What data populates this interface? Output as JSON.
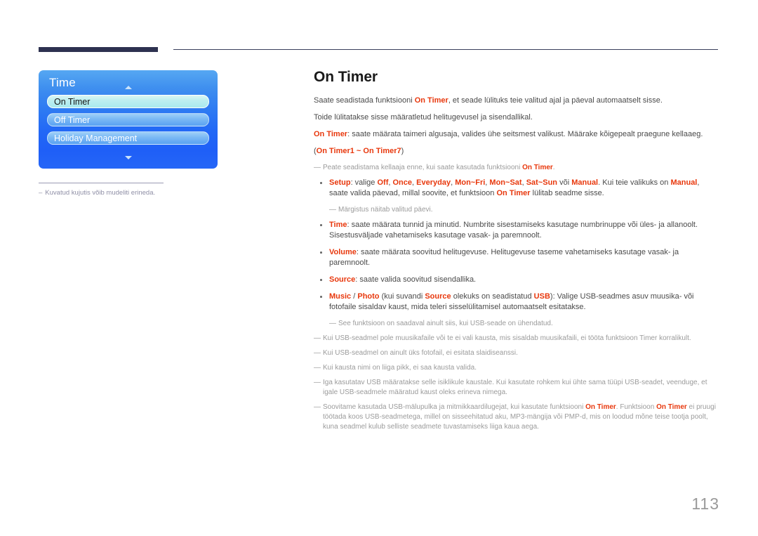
{
  "accent_color": "#e8380d",
  "panel_blue": "#2268f6",
  "rule_color": "#2e3250",
  "header": {
    "rule_block_label": "header-rule-block",
    "rule_line_label": "header-rule-line"
  },
  "osd": {
    "title": "Time",
    "up_arrow": "chevron-up-icon",
    "down_arrow": "chevron-down-icon",
    "items": [
      {
        "label": "On Timer",
        "selected": true
      },
      {
        "label": "Off Timer",
        "selected": false
      },
      {
        "label": "Holiday Management",
        "selected": false
      }
    ],
    "caption_dash": "–",
    "caption": "Kuvatud kujutis võib mudeliti erineda."
  },
  "doc": {
    "title": "On Timer",
    "page_number": "113",
    "paragraphs": [
      {
        "id": "intro1",
        "runs": [
          {
            "t": "Saate seadistada funktsiooni ",
            "hl": false
          },
          {
            "t": "On Timer",
            "hl": true
          },
          {
            "t": ", et seade lülituks teie valitud ajal ja päeval automaatselt sisse.",
            "hl": false
          }
        ]
      },
      {
        "id": "intro2",
        "runs": [
          {
            "t": "Toide lülitatakse sisse määratletud helitugevusel ja sisendallikal.",
            "hl": false
          }
        ]
      },
      {
        "id": "intro3",
        "runs": [
          {
            "t": "On Timer",
            "hl": true
          },
          {
            "t": ": saate määrata taimeri algusaja, valides ühe seitsmest valikust. Määrake kõigepealt praegune kellaaeg.",
            "hl": false
          }
        ]
      },
      {
        "id": "intro4",
        "runs": [
          {
            "t": "(",
            "hl": false
          },
          {
            "t": "On Timer1 ~ On Timer7",
            "hl": true
          },
          {
            "t": ")",
            "hl": false
          }
        ]
      }
    ],
    "note_after_intro": {
      "dash": "—",
      "runs": [
        {
          "t": "Peate seadistama kellaaja enne, kui saate kasutada funktsiooni ",
          "hl": false
        },
        {
          "t": "On Timer",
          "hl": true
        },
        {
          "t": ".",
          "hl": false
        }
      ]
    },
    "bullets": [
      {
        "id": "setup",
        "runs": [
          {
            "t": "Setup",
            "hl": true
          },
          {
            "t": ": valige ",
            "hl": false
          },
          {
            "t": "Off",
            "hl": true
          },
          {
            "t": ", ",
            "hl": false
          },
          {
            "t": "Once",
            "hl": true
          },
          {
            "t": ", ",
            "hl": false
          },
          {
            "t": "Everyday",
            "hl": true
          },
          {
            "t": ", ",
            "hl": false
          },
          {
            "t": "Mon~Fri",
            "hl": true
          },
          {
            "t": ", ",
            "hl": false
          },
          {
            "t": "Mon~Sat",
            "hl": true
          },
          {
            "t": ", ",
            "hl": false
          },
          {
            "t": "Sat~Sun",
            "hl": true
          },
          {
            "t": " või ",
            "hl": false
          },
          {
            "t": "Manual",
            "hl": true
          },
          {
            "t": ". Kui teie valikuks on ",
            "hl": false
          },
          {
            "t": "Manual",
            "hl": true
          },
          {
            "t": ", saate valida päevad, millal soovite, et funktsioon ",
            "hl": false
          },
          {
            "t": "On Timer",
            "hl": true
          },
          {
            "t": " lülitab seadme sisse.",
            "hl": false
          }
        ],
        "note": {
          "dash": "—",
          "runs": [
            {
              "t": "Märgistus näitab valitud päevi.",
              "hl": false
            }
          ]
        }
      },
      {
        "id": "time",
        "runs": [
          {
            "t": "Time",
            "hl": true
          },
          {
            "t": ": saate määrata tunnid ja minutid. Numbrite sisestamiseks kasutage numbrinuppe või üles- ja allanoolt. Sisestusväljade vahetamiseks kasutage vasak- ja paremnoolt.",
            "hl": false
          }
        ]
      },
      {
        "id": "volume",
        "runs": [
          {
            "t": "Volume",
            "hl": true
          },
          {
            "t": ": saate määrata soovitud helitugevuse. Helitugevuse taseme vahetamiseks kasutage vasak- ja paremnoolt.",
            "hl": false
          }
        ]
      },
      {
        "id": "source",
        "runs": [
          {
            "t": "Source",
            "hl": true
          },
          {
            "t": ": saate valida soovitud sisendallika.",
            "hl": false
          }
        ]
      },
      {
        "id": "music-photo",
        "runs": [
          {
            "t": "Music",
            "hl": true
          },
          {
            "t": " / ",
            "hl": false
          },
          {
            "t": "Photo",
            "hl": true
          },
          {
            "t": " (kui suvandi ",
            "hl": false
          },
          {
            "t": "Source",
            "hl": true
          },
          {
            "t": " olekuks on seadistatud ",
            "hl": false
          },
          {
            "t": "USB",
            "hl": true
          },
          {
            "t": "): Valige USB-seadmes asuv muusika- või fotofaile sisaldav kaust, mida teleri sisselülitamisel automaatselt esitatakse.",
            "hl": false
          }
        ],
        "note": {
          "dash": "—",
          "runs": [
            {
              "t": "See funktsioon on saadaval ainult siis, kui USB-seade on ühendatud.",
              "hl": false
            }
          ]
        }
      }
    ],
    "trailing_notes": [
      {
        "id": "note-no-music",
        "dash": "—",
        "runs": [
          {
            "t": "Kui USB-seadmel pole muusikafaile või te ei vali kausta, mis sisaldab muusikafaili, ei tööta funktsioon Timer korralikult.",
            "hl": false
          }
        ]
      },
      {
        "id": "note-one-photo",
        "dash": "—",
        "runs": [
          {
            "t": "Kui USB-seadmel on ainult üks fotofail, ei esitata slaidiseanssi.",
            "hl": false
          }
        ]
      },
      {
        "id": "note-long-name",
        "dash": "—",
        "runs": [
          {
            "t": "Kui kausta nimi on liiga pikk, ei saa kausta valida.",
            "hl": false
          }
        ]
      },
      {
        "id": "note-usb-folder",
        "dash": "—",
        "runs": [
          {
            "t": "Iga kasutatav USB määratakse selle isiklikule kaustale. Kui kasutate rohkem kui ühte sama tüüpi USB-seadet, veenduge, et igale USB-seadmele määratud kaust oleks erineva nimega.",
            "hl": false
          }
        ]
      },
      {
        "id": "note-recommend",
        "dash": "—",
        "runs": [
          {
            "t": "Soovitame kasutada USB-mälupulka ja mitmikkaardilugejat, kui kasutate funktsiooni ",
            "hl": false
          },
          {
            "t": "On Timer",
            "hl": true
          },
          {
            "t": ". Funktsioon ",
            "hl": false
          },
          {
            "t": "On Timer",
            "hl": true
          },
          {
            "t": " ei pruugi töötada koos USB-seadmetega, millel on sisseehitatud aku, MP3-mängija või PMP-d, mis on loodud mõne teise tootja poolt, kuna seadmel kulub selliste seadmete tuvastamiseks liiga kaua aega.",
            "hl": false
          }
        ]
      }
    ]
  }
}
